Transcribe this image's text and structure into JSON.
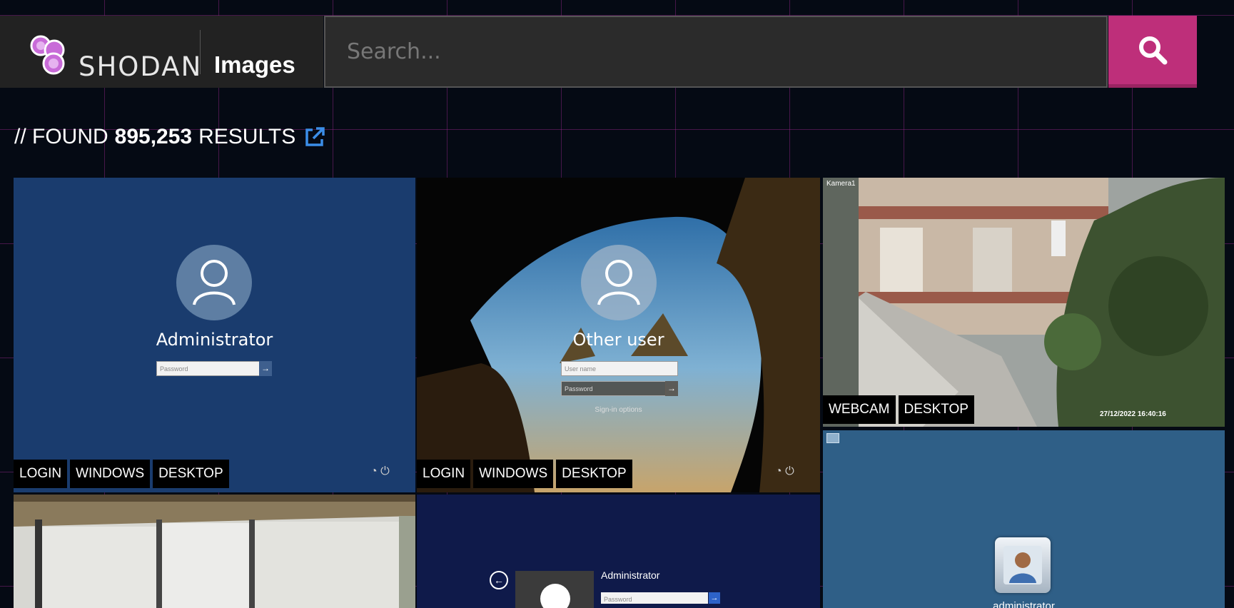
{
  "header": {
    "brand": "SHODAN",
    "section": "Images",
    "search_placeholder": "Search..."
  },
  "results": {
    "prefix": "// FOUND",
    "count": "895,253",
    "suffix": "RESULTS"
  },
  "tiles": [
    {
      "title": "Administrator",
      "password_placeholder": "Password",
      "tags": [
        "LOGIN",
        "WINDOWS",
        "DESKTOP"
      ]
    },
    {
      "title": "Other user",
      "username_placeholder": "User name",
      "password_placeholder": "Password",
      "signin_options": "Sign-in options",
      "tags": [
        "LOGIN",
        "WINDOWS",
        "DESKTOP"
      ]
    },
    {
      "camera_label": "Kamera1",
      "timestamp": "27/12/2022 16:40:16",
      "tags": [
        "WEBCAM",
        "DESKTOP"
      ]
    },
    {
      "user": "administrator"
    },
    {
      "title": "Administrator",
      "password_placeholder": "Password"
    }
  ],
  "colors": {
    "accent": "#be2f7a",
    "link": "#3b8ee8",
    "login_bg": "#1a3c6e"
  }
}
